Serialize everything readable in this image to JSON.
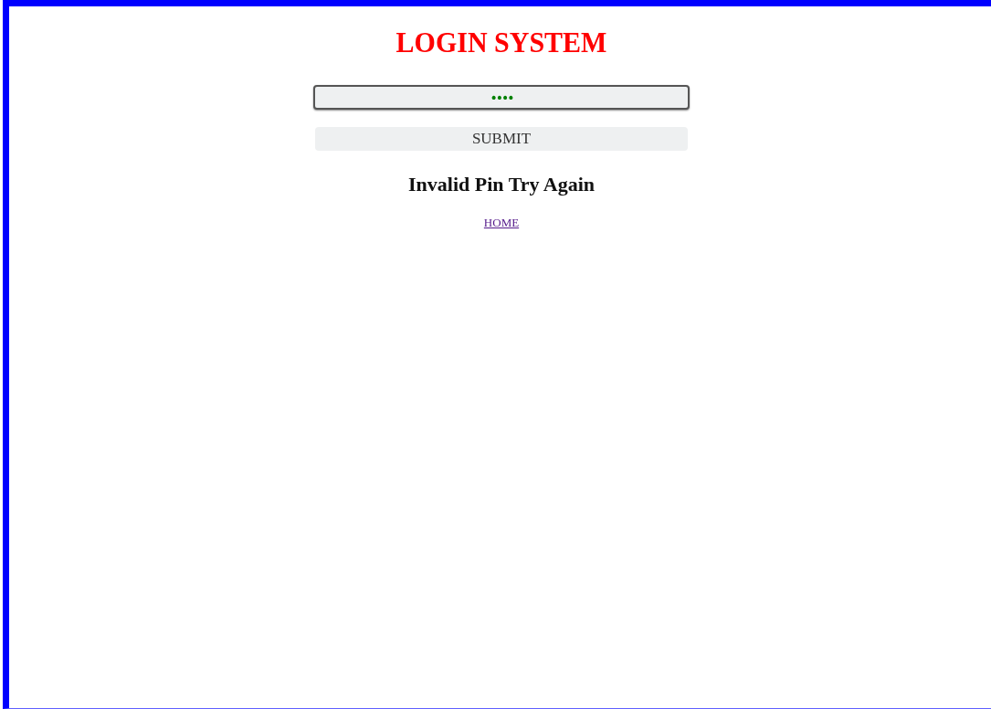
{
  "title": "LOGIN SYSTEM",
  "pin_field": {
    "value": "••••"
  },
  "submit_button": {
    "label": "SUBMIT"
  },
  "message": "Invalid Pin Try Again",
  "home_link": {
    "label": "HOME",
    "visited": true
  }
}
